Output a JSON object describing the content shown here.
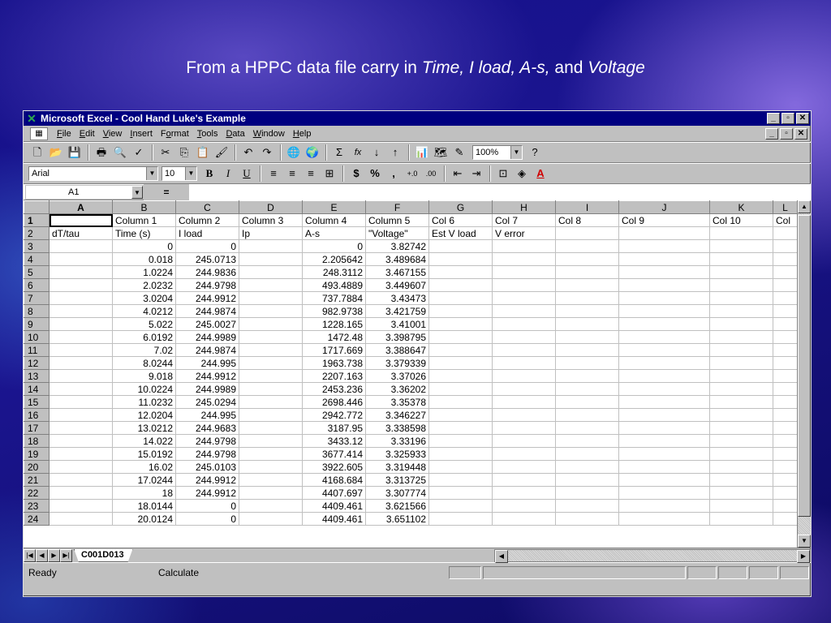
{
  "slide": {
    "title_prefix": "From a HPPC data file carry in ",
    "title_time": "Time,",
    "title_iload": " I load,",
    "title_as": " A-s,",
    "title_and": " and ",
    "title_voltage": "Voltage"
  },
  "window": {
    "title": "Microsoft Excel - Cool Hand Luke's Example",
    "buttons": {
      "minimize": "_",
      "restore": "▫",
      "close": "✕"
    }
  },
  "menu": {
    "items": [
      {
        "pre": "",
        "key": "F",
        "post": "ile"
      },
      {
        "pre": "",
        "key": "E",
        "post": "dit"
      },
      {
        "pre": "",
        "key": "V",
        "post": "iew"
      },
      {
        "pre": "",
        "key": "I",
        "post": "nsert"
      },
      {
        "pre": "F",
        "key": "o",
        "post": "rmat"
      },
      {
        "pre": "",
        "key": "T",
        "post": "ools"
      },
      {
        "pre": "",
        "key": "D",
        "post": "ata"
      },
      {
        "pre": "",
        "key": "W",
        "post": "indow"
      },
      {
        "pre": "",
        "key": "H",
        "post": "elp"
      }
    ]
  },
  "toolbar": {
    "zoom": "100%",
    "font_name": "Arial",
    "font_size": "10",
    "bold": "B",
    "italic": "I",
    "underline": "U",
    "currency": "$",
    "percent": "%",
    "comma": ",",
    "sum": "Σ",
    "function": "fx"
  },
  "formula_bar": {
    "name_box": "A1",
    "equals": "="
  },
  "columns": [
    "A",
    "B",
    "C",
    "D",
    "E",
    "F",
    "G",
    "H",
    "I",
    "J",
    "K",
    "L"
  ],
  "rows": [
    {
      "n": "1",
      "cells": [
        "",
        "Column 1",
        "Column 2",
        "Column 3",
        "Column 4",
        "Column 5",
        "Col 6",
        "Col 7",
        "Col 8",
        "Col 9",
        "Col 10",
        "Col"
      ]
    },
    {
      "n": "2",
      "cells": [
        "dT/tau",
        "Time (s)",
        "I load",
        "Ip",
        "A-s",
        "\"Voltage\"",
        "Est V load",
        "V error",
        "",
        "",
        "",
        ""
      ]
    },
    {
      "n": "3",
      "cells": [
        "",
        "0",
        "0",
        "",
        "0",
        "3.82742",
        "",
        "",
        "",
        "",
        "",
        ""
      ]
    },
    {
      "n": "4",
      "cells": [
        "",
        "0.018",
        "245.0713",
        "",
        "2.205642",
        "3.489684",
        "",
        "",
        "",
        "",
        "",
        ""
      ]
    },
    {
      "n": "5",
      "cells": [
        "",
        "1.0224",
        "244.9836",
        "",
        "248.3112",
        "3.467155",
        "",
        "",
        "",
        "",
        "",
        ""
      ]
    },
    {
      "n": "6",
      "cells": [
        "",
        "2.0232",
        "244.9798",
        "",
        "493.4889",
        "3.449607",
        "",
        "",
        "",
        "",
        "",
        ""
      ]
    },
    {
      "n": "7",
      "cells": [
        "",
        "3.0204",
        "244.9912",
        "",
        "737.7884",
        "3.43473",
        "",
        "",
        "",
        "",
        "",
        ""
      ]
    },
    {
      "n": "8",
      "cells": [
        "",
        "4.0212",
        "244.9874",
        "",
        "982.9738",
        "3.421759",
        "",
        "",
        "",
        "",
        "",
        ""
      ]
    },
    {
      "n": "9",
      "cells": [
        "",
        "5.022",
        "245.0027",
        "",
        "1228.165",
        "3.41001",
        "",
        "",
        "",
        "",
        "",
        ""
      ]
    },
    {
      "n": "10",
      "cells": [
        "",
        "6.0192",
        "244.9989",
        "",
        "1472.48",
        "3.398795",
        "",
        "",
        "",
        "",
        "",
        ""
      ]
    },
    {
      "n": "11",
      "cells": [
        "",
        "7.02",
        "244.9874",
        "",
        "1717.669",
        "3.388647",
        "",
        "",
        "",
        "",
        "",
        ""
      ]
    },
    {
      "n": "12",
      "cells": [
        "",
        "8.0244",
        "244.995",
        "",
        "1963.738",
        "3.379339",
        "",
        "",
        "",
        "",
        "",
        ""
      ]
    },
    {
      "n": "13",
      "cells": [
        "",
        "9.018",
        "244.9912",
        "",
        "2207.163",
        "3.37026",
        "",
        "",
        "",
        "",
        "",
        ""
      ]
    },
    {
      "n": "14",
      "cells": [
        "",
        "10.0224",
        "244.9989",
        "",
        "2453.236",
        "3.36202",
        "",
        "",
        "",
        "",
        "",
        ""
      ]
    },
    {
      "n": "15",
      "cells": [
        "",
        "11.0232",
        "245.0294",
        "",
        "2698.446",
        "3.35378",
        "",
        "",
        "",
        "",
        "",
        ""
      ]
    },
    {
      "n": "16",
      "cells": [
        "",
        "12.0204",
        "244.995",
        "",
        "2942.772",
        "3.346227",
        "",
        "",
        "",
        "",
        "",
        ""
      ]
    },
    {
      "n": "17",
      "cells": [
        "",
        "13.0212",
        "244.9683",
        "",
        "3187.95",
        "3.338598",
        "",
        "",
        "",
        "",
        "",
        ""
      ]
    },
    {
      "n": "18",
      "cells": [
        "",
        "14.022",
        "244.9798",
        "",
        "3433.12",
        "3.33196",
        "",
        "",
        "",
        "",
        "",
        ""
      ]
    },
    {
      "n": "19",
      "cells": [
        "",
        "15.0192",
        "244.9798",
        "",
        "3677.414",
        "3.325933",
        "",
        "",
        "",
        "",
        "",
        ""
      ]
    },
    {
      "n": "20",
      "cells": [
        "",
        "16.02",
        "245.0103",
        "",
        "3922.605",
        "3.319448",
        "",
        "",
        "",
        "",
        "",
        ""
      ]
    },
    {
      "n": "21",
      "cells": [
        "",
        "17.0244",
        "244.9912",
        "",
        "4168.684",
        "3.313725",
        "",
        "",
        "",
        "",
        "",
        ""
      ]
    },
    {
      "n": "22",
      "cells": [
        "",
        "18",
        "244.9912",
        "",
        "4407.697",
        "3.307774",
        "",
        "",
        "",
        "",
        "",
        ""
      ]
    },
    {
      "n": "23",
      "cells": [
        "",
        "18.0144",
        "0",
        "",
        "4409.461",
        "3.621566",
        "",
        "",
        "",
        "",
        "",
        ""
      ]
    },
    {
      "n": "24",
      "cells": [
        "",
        "20.0124",
        "0",
        "",
        "4409.461",
        "3.651102",
        "",
        "",
        "",
        "",
        "",
        ""
      ]
    }
  ],
  "sheet_tab": "C001D013",
  "status": {
    "ready": "Ready",
    "calculate": "Calculate"
  },
  "colors": {
    "title_bar": "#000080",
    "chrome": "#c0c0c0",
    "slide_text": "#ffffff"
  }
}
